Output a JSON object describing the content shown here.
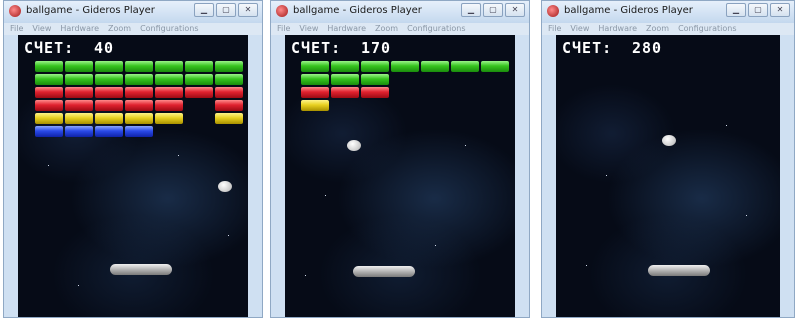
{
  "colors": {
    "green": "#36c41e",
    "red": "#e0222f",
    "yellow": "#e8d020",
    "blue": "#2a4ae8",
    "space": "#060b17"
  },
  "window": {
    "title": "ballgame - Gideros Player",
    "menu": [
      "File",
      "View",
      "Hardware",
      "Zoom",
      "Configurations"
    ],
    "controls": {
      "minimize": "▁",
      "maximize": "▢",
      "close": "✕"
    }
  },
  "screens": [
    {
      "score_label": "СЧЕТ:",
      "score": "40"
    },
    {
      "score_label": "СЧЕТ:",
      "score": "170"
    },
    {
      "score_label": "СЧЕТ:",
      "score": "280"
    }
  ]
}
